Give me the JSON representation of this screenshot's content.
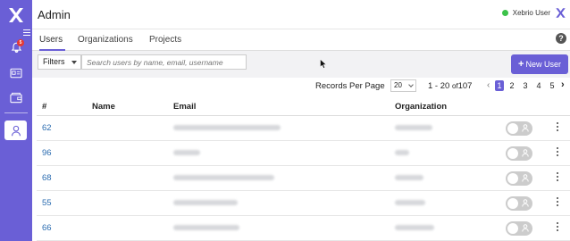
{
  "app": {
    "title": "Admin",
    "user_name": "Xebrio User",
    "notification_count": "5"
  },
  "tabs": [
    {
      "label": "Users",
      "active": true
    },
    {
      "label": "Organizations",
      "active": false
    },
    {
      "label": "Projects",
      "active": false
    }
  ],
  "toolbar": {
    "filters_label": "Filters",
    "search_placeholder": "Search users by name, email, username",
    "new_user_label": "New User"
  },
  "pagination": {
    "records_per_page_label": "Records Per Page",
    "records_per_page_value": "20",
    "range_label": "1 - 20",
    "of_label": "of",
    "total": "107",
    "prev_symbol": "‹",
    "next_symbol": "›",
    "pages": [
      "1",
      "2",
      "3",
      "4",
      "5"
    ],
    "current_page": "1"
  },
  "table": {
    "columns": [
      "#",
      "Name",
      "Email",
      "Organization"
    ],
    "rows": [
      {
        "id": "62",
        "active": false
      },
      {
        "id": "96",
        "active": false
      },
      {
        "id": "68",
        "active": false
      },
      {
        "id": "55",
        "active": false
      },
      {
        "id": "66",
        "active": false
      }
    ]
  },
  "colors": {
    "accent": "#6a5fd6",
    "link": "#2b6cb0",
    "online": "#3cc24a",
    "badge": "#e53935"
  },
  "icons": {
    "logo": "x-logo-icon",
    "menu": "hamburger-icon",
    "notifications": "bell-icon",
    "dashboard": "id-card-icon",
    "wallet": "wallet-icon",
    "users": "user-icon",
    "help": "help-icon",
    "row_menu": "kebab-icon",
    "toggle": "user-toggle-icon"
  }
}
